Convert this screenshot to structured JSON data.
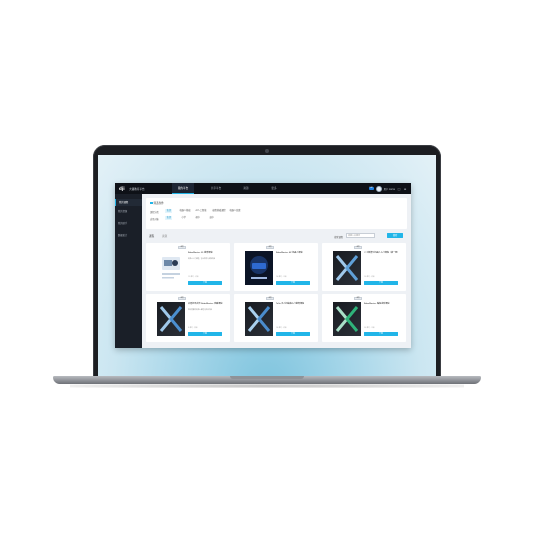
{
  "app": {
    "logo_mark": "dji",
    "logo_text": "大疆教育平台",
    "nav_tabs": [
      {
        "label": "我的平台",
        "active": true
      },
      {
        "label": "共享平台",
        "active": false
      },
      {
        "label": "资源",
        "active": false
      },
      {
        "label": "更多",
        "active": false
      }
    ],
    "vip_label": "VIP",
    "user_label": "用户 name",
    "bell_icon": "bell-icon",
    "menu_icon": "menu-icon"
  },
  "sidebar": {
    "items": [
      {
        "label": "我的课程",
        "active": true
      },
      {
        "label": "我的资源",
        "active": false
      },
      {
        "label": "我的助手",
        "active": false
      },
      {
        "label": "数据统计",
        "active": false
      }
    ]
  },
  "filter": {
    "title": "筛选条件",
    "rows": [
      {
        "label": "课程分类",
        "options": [
          "全部",
          "机器人基础",
          "AI人工智能",
          "编程基础课程",
          "机器人竞赛"
        ],
        "selected": 0
      },
      {
        "label": "适用对象",
        "options": [
          "全部",
          "小学",
          "初中",
          "高中"
        ],
        "selected": 0
      }
    ]
  },
  "list_bar": {
    "tab_all": "课程",
    "tab_other": "资源",
    "search_label": "搜索课程",
    "search_placeholder": "请输入关键词",
    "search_button": "搜索"
  },
  "cards": [
    {
      "tag": "课程",
      "title": "RoboMaster S1 教育课程",
      "desc": "机器人入门课程，包含实例与讲解内容",
      "meta": "12 课时 · 初级",
      "button": "下载",
      "cover": "light"
    },
    {
      "tag": "课程",
      "title": "RoboMaster EP 机器人课程",
      "desc": "",
      "meta": "16 课时 · 中级",
      "button": "下载",
      "cover": "dark-ep"
    },
    {
      "tag": "课程",
      "title": "人工智能与机器人入门课程（第一册）",
      "desc": "",
      "meta": "10 课时 · 初级",
      "button": "下载",
      "cover": "dark-x-blue"
    },
    {
      "tag": "课程",
      "title": "大疆机甲大师 RoboMaster 竞赛课程",
      "desc": "面向竞赛的机器人课程与实训内容",
      "meta": "8 课时 · 高级",
      "button": "下载",
      "cover": "dark-x-blue"
    },
    {
      "tag": "课程",
      "title": "Tello 无人机编程入门教育课程",
      "desc": "",
      "meta": "14 课时 · 初级",
      "button": "下载",
      "cover": "dark-x-blue"
    },
    {
      "tag": "课程",
      "title": "RoboMaster 编程进阶课程",
      "desc": "",
      "meta": "20 课时 · 中级",
      "button": "下载",
      "cover": "dark-x-green"
    }
  ]
}
